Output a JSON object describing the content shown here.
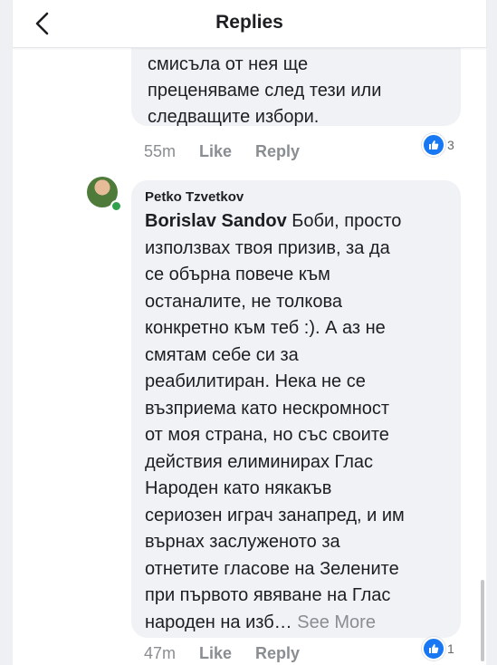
{
  "header": {
    "title": "Replies"
  },
  "comment1": {
    "text": "смисъла от нея ще\nпреценяваме след тези или\nследващите избори.",
    "time": "55m",
    "like_label": "Like",
    "reply_label": "Reply",
    "reaction_count": "3"
  },
  "comment2": {
    "author": "Petko Tzvetkov",
    "mention": "Borislav Sandov",
    "text": " Боби, просто\nизползвах твоя призив, за да\nсе обърна повече към\nостаналите, не толкова\nконкретно към теб :). А аз не\nсмятам себе си за\nреабилитиран. Нека не се\nвъзприема като нескромност\nот моя страна, но със своите\nдействия елиминирах Глас\nНароден като някакъв\nсериозен играч занапред, и им\nвърнах заслуженото за\nотнетите гласове на Зелените\nпри първото явяване на Глас\nнароден на изб…",
    "see_more": "See More",
    "time": "47m",
    "like_label": "Like",
    "reply_label": "Reply",
    "reaction_count": "1"
  },
  "icons": [
    "back-arrow-icon",
    "like-reaction-icon"
  ],
  "colors": {
    "accent": "#1877f2",
    "bubble": "#f0f2f5",
    "meta": "#8a8d91",
    "online": "#31a24c"
  }
}
